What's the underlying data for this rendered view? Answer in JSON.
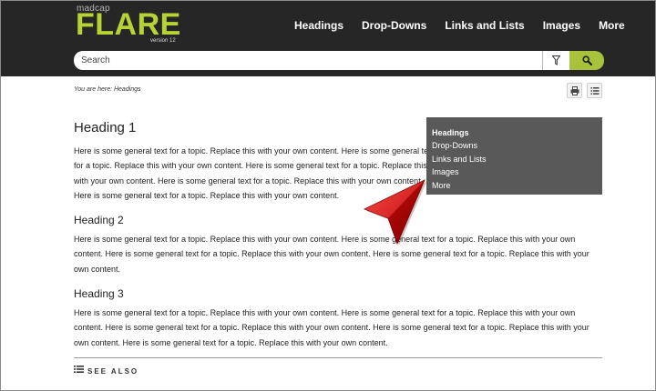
{
  "header": {
    "logo_small": "madcap",
    "logo_big": "FLARE",
    "logo_version": "version 12",
    "nav": [
      {
        "label": "Headings"
      },
      {
        "label": "Drop-Downs"
      },
      {
        "label": "Links and Lists"
      },
      {
        "label": "Images"
      },
      {
        "label": "More"
      }
    ],
    "search": {
      "placeholder": "Search",
      "filter_icon": "filter-icon",
      "search_icon": "magnifier-icon"
    },
    "accent_color": "#a9c23c"
  },
  "breadcrumb": {
    "text": "You are here: Headings"
  },
  "tools": {
    "print_icon": "printer-icon",
    "toc_icon": "list-icon"
  },
  "dropdown": {
    "items": [
      {
        "label": "Headings"
      },
      {
        "label": "Drop-Downs"
      },
      {
        "label": "Links and Lists"
      },
      {
        "label": "Images"
      },
      {
        "label": "More"
      }
    ]
  },
  "content": {
    "heading1": "Heading 1",
    "para1": "Here is some general text for a topic. Replace this with your own content. Here is some general text for a topic. Replace this with your own content. Here is some general text for a topic. Replace this with your own content. Here is some general text for a topic. Replace this with your own content. Here is some general text for a topic. Replace this with your own content.",
    "heading2": "Heading 2",
    "para2": "Here is some general text for a topic. Replace this with your own content. Here is some general text for a topic. Replace this with your own content. Here is some general text for a topic. Replace this with your own content. Here is some general text for a topic. Replace this with your own content.",
    "heading3": "Heading 3",
    "para3": "Here is some general text for a topic. Replace this with your own content. Here is some general text for a topic. Replace this with your own content. Here is some general text for a topic. Replace this with your own content. Here is some general text for a topic. Replace this with your own content. Here is some general text for a topic. Replace this with your own content.",
    "see_also": "SEE ALSO"
  }
}
